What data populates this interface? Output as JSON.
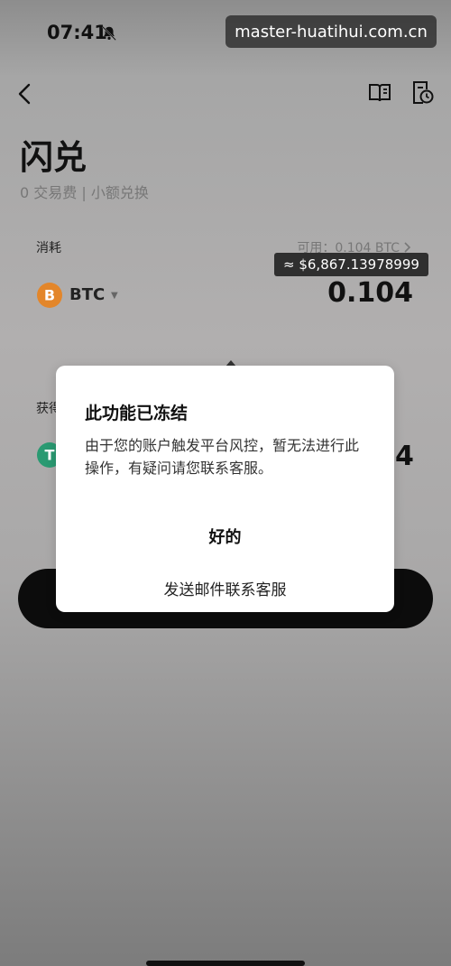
{
  "status": {
    "time": "07:41"
  },
  "watermark": "master-huatihui.com.cn",
  "header": {
    "title": "闪兑",
    "subtitle": "0 交易费 | 小额兑换"
  },
  "consume": {
    "label": "消耗",
    "available": "可用：0.104 BTC",
    "usd_tooltip": "≈ $6,867.13978999",
    "coin": "BTC",
    "amount": "0.104"
  },
  "get": {
    "label": "获得",
    "amount_tail": "4"
  },
  "dialog": {
    "title": "此功能已冻结",
    "message": "由于您的账户触发平台风控，暂无法进行此操作，有疑问请您联系客服。",
    "ok_label": "好的",
    "mail_label": "发送邮件联系客服"
  },
  "icons": {
    "back": "chevron-left-icon",
    "book": "book-icon",
    "history": "history-clock-icon",
    "bell": "bell-muted-icon",
    "btc": "bitcoin-icon",
    "usdt": "tether-icon"
  },
  "colors": {
    "btc": "#f7931a",
    "usdt": "#26a17b"
  }
}
